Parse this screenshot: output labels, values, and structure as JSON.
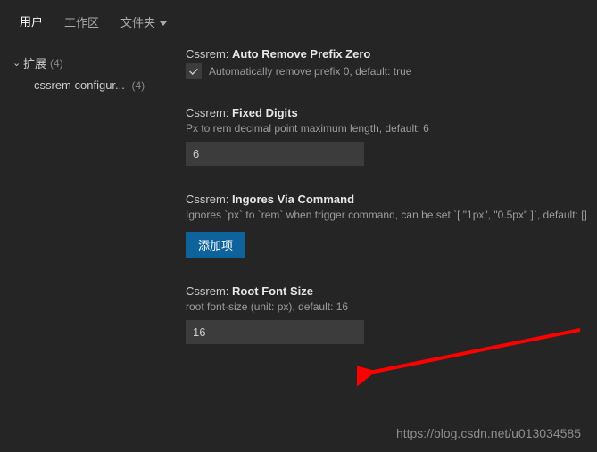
{
  "tabs": {
    "user": "用户",
    "workspace": "工作区",
    "folder": "文件夹"
  },
  "sidebar": {
    "group": {
      "label": "扩展",
      "count": "(4)"
    },
    "children": [
      {
        "label": "cssrem configur...",
        "count": "(4)"
      }
    ]
  },
  "settings": {
    "autoRemove": {
      "prefix": "Cssrem:",
      "name": "Auto Remove Prefix Zero",
      "desc": "Automatically remove prefix 0, default: true",
      "checked": true
    },
    "fixedDigits": {
      "prefix": "Cssrem:",
      "name": "Fixed Digits",
      "desc": "Px to rem decimal point maximum length, default: 6",
      "value": "6"
    },
    "ignores": {
      "prefix": "Cssrem:",
      "name": "Ingores Via Command",
      "desc": "Ignores `px` to `rem` when trigger command, can be set `[ \"1px\", \"0.5px\" ]`, default: []",
      "addButton": "添加项"
    },
    "rootFontSize": {
      "prefix": "Cssrem:",
      "name": "Root Font Size",
      "desc": "root font-size (unit: px), default: 16",
      "value": "16"
    }
  },
  "watermark": "https://blog.csdn.net/u013034585"
}
